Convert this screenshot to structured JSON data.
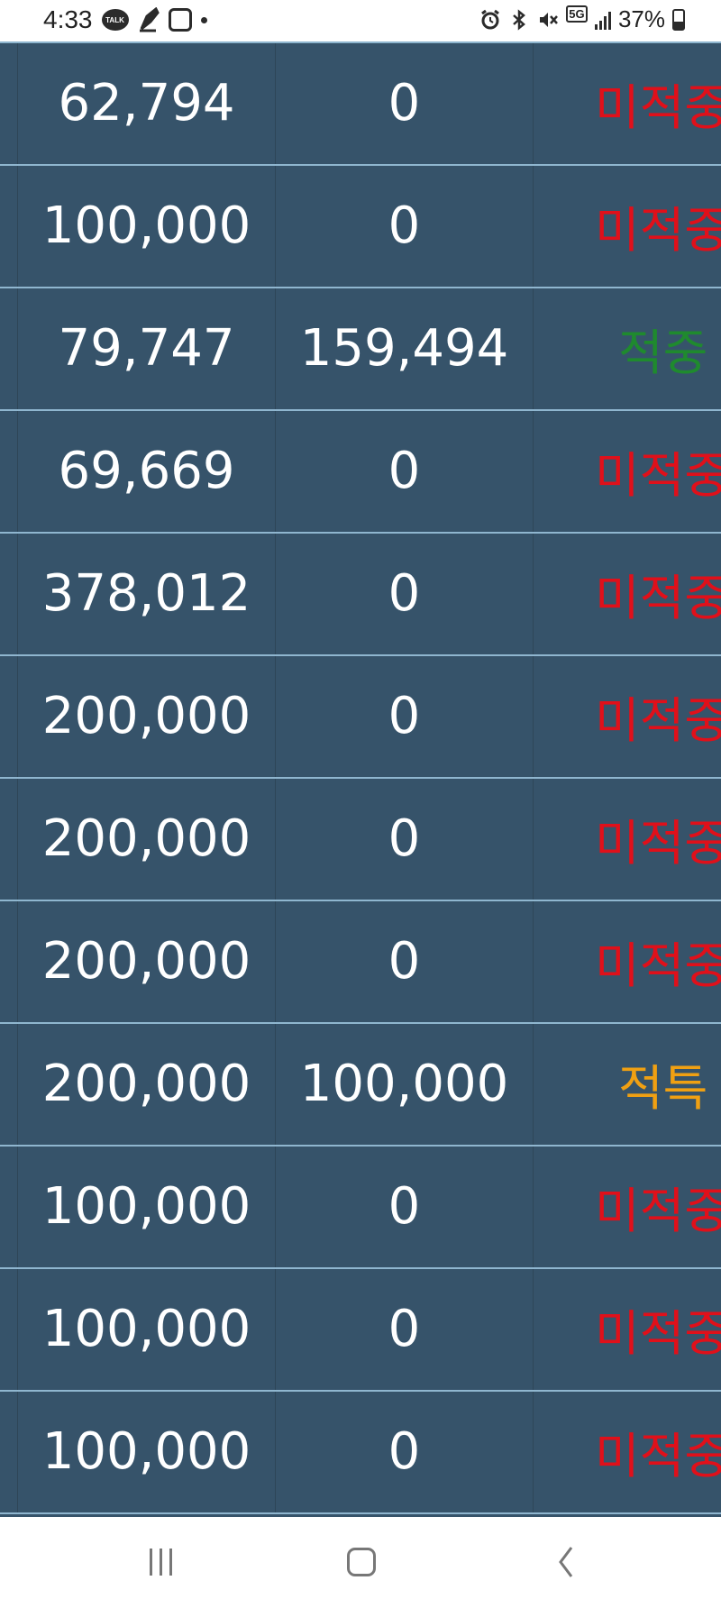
{
  "status_bar": {
    "time": "4:33",
    "notifications": [
      "talk-icon",
      "pen-icon",
      "app-box-icon",
      "dot-icon"
    ],
    "talk_label": "TALK",
    "battery": "37%",
    "network": "5G",
    "icons": [
      "alarm-icon",
      "bluetooth-icon",
      "mute-icon",
      "5g-icon",
      "signal-icon",
      "battery-icon"
    ]
  },
  "table": {
    "rows": [
      {
        "amount": "62,794",
        "payout": "0",
        "result": "미적중",
        "status": "red"
      },
      {
        "amount": "100,000",
        "payout": "0",
        "result": "미적중",
        "status": "red"
      },
      {
        "amount": "79,747",
        "payout": "159,494",
        "result": "적중",
        "status": "green"
      },
      {
        "amount": "69,669",
        "payout": "0",
        "result": "미적중",
        "status": "red"
      },
      {
        "amount": "378,012",
        "payout": "0",
        "result": "미적중",
        "status": "red"
      },
      {
        "amount": "200,000",
        "payout": "0",
        "result": "미적중",
        "status": "red"
      },
      {
        "amount": "200,000",
        "payout": "0",
        "result": "미적중",
        "status": "red"
      },
      {
        "amount": "200,000",
        "payout": "0",
        "result": "미적중",
        "status": "red"
      },
      {
        "amount": "200,000",
        "payout": "100,000",
        "result": "적특",
        "status": "orange"
      },
      {
        "amount": "100,000",
        "payout": "0",
        "result": "미적중",
        "status": "red"
      },
      {
        "amount": "100,000",
        "payout": "0",
        "result": "미적중",
        "status": "red"
      },
      {
        "amount": "100,000",
        "payout": "0",
        "result": "미적중",
        "status": "red"
      }
    ]
  },
  "colors": {
    "table_bg": "#36536a",
    "row_divider": "#8fb6cf",
    "miss": "#e0101a",
    "hit": "#1f8a2e",
    "special": "#f0a012"
  },
  "nav_bar": {
    "buttons": [
      "recent-apps-button",
      "home-button",
      "back-button"
    ]
  }
}
